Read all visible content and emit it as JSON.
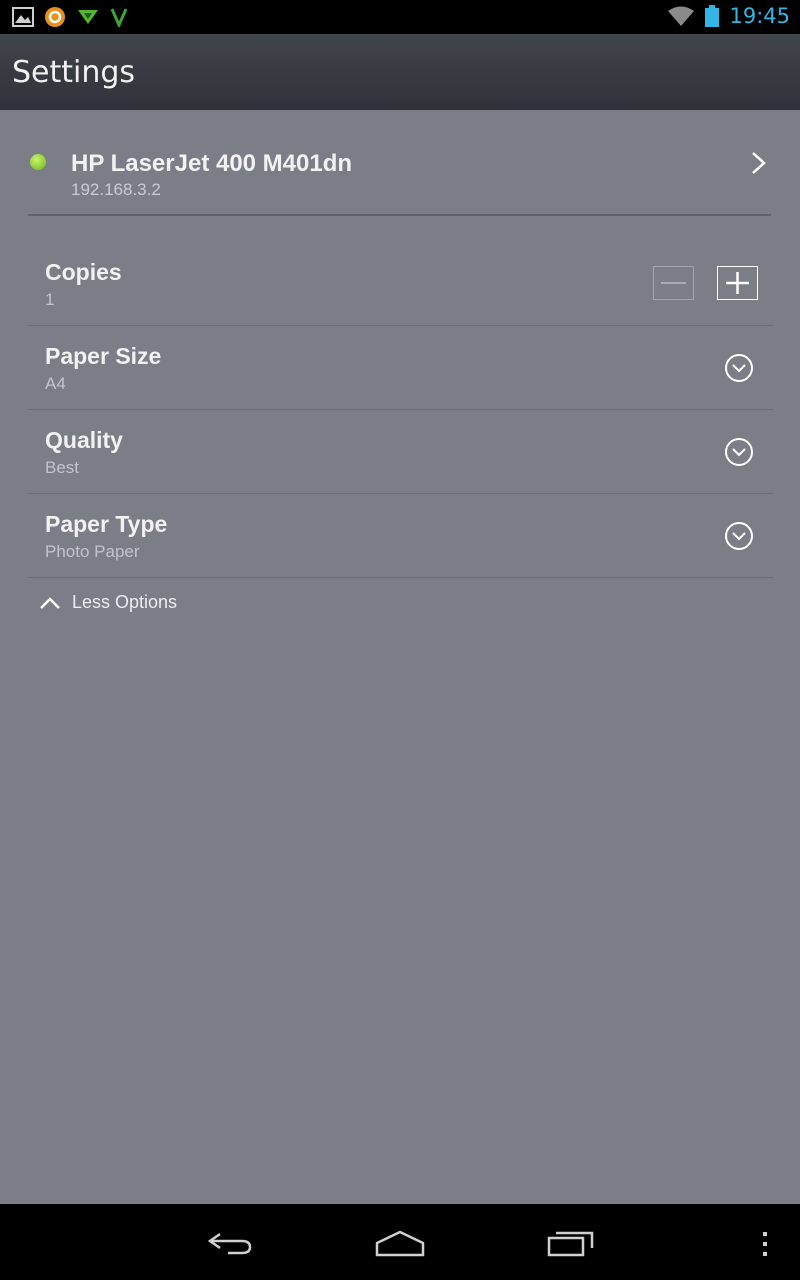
{
  "status_bar": {
    "time": "19:45",
    "notification_icons": [
      "gallery-icon",
      "circle-app-icon",
      "download-icon",
      "vine-icon"
    ],
    "system_icons": [
      "wifi-icon",
      "battery-icon"
    ],
    "time_color": "#35b5e5"
  },
  "action_bar": {
    "title": "Settings"
  },
  "printer": {
    "name": "HP LaserJet 400 M401dn",
    "ip": "192.168.3.2",
    "status_color": "#8bd12b"
  },
  "settings": {
    "copies": {
      "label": "Copies",
      "value": "1"
    },
    "paper_size": {
      "label": "Paper Size",
      "value": "A4"
    },
    "quality": {
      "label": "Quality",
      "value": "Best"
    },
    "paper_type": {
      "label": "Paper Type",
      "value": "Photo Paper"
    }
  },
  "options_toggle": {
    "label": "Less Options"
  },
  "nav_bar": {
    "buttons": [
      "back-icon",
      "home-icon",
      "recents-icon",
      "overflow-menu-icon"
    ]
  }
}
